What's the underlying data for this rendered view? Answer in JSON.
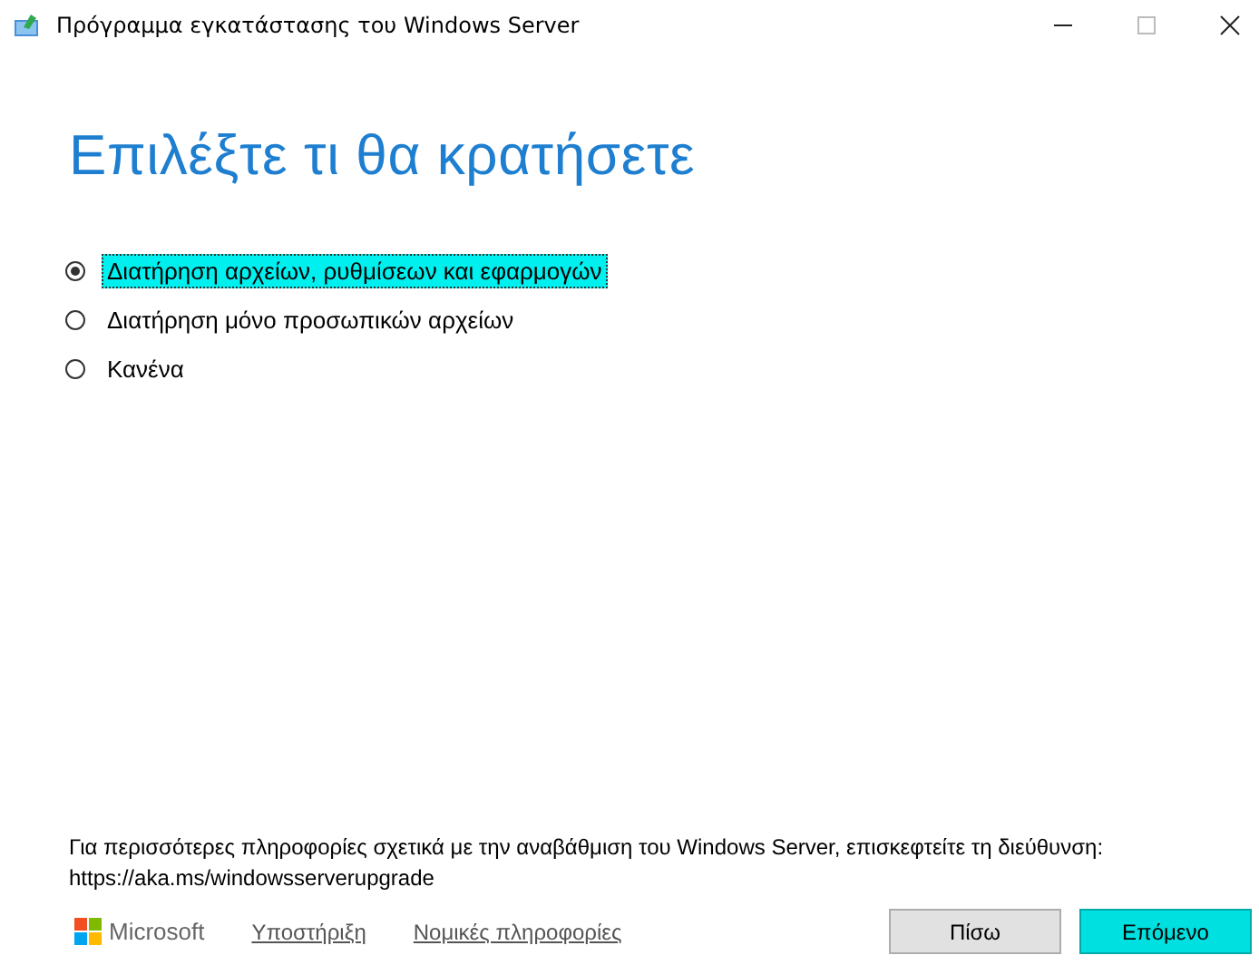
{
  "window": {
    "title": "Πρόγραμμα εγκατάστασης του Windows Server"
  },
  "heading": "Επιλέξτε τι θα κρατήσετε",
  "options": [
    {
      "label": "Διατήρηση αρχείων, ρυθμίσεων και εφαρμογών",
      "selected": true,
      "focused": true
    },
    {
      "label": "Διατήρηση μόνο προσωπικών αρχείων",
      "selected": false,
      "focused": false
    },
    {
      "label": "Κανένα",
      "selected": false,
      "focused": false
    }
  ],
  "info": "Για περισσότερες πληροφορίες σχετικά με την αναβάθμιση του Windows Server, επισκεφτείτε τη διεύθυνση: https://aka.ms/windowsserverupgrade",
  "footer": {
    "brand": "Microsoft",
    "links": [
      "Υποστήριξη",
      "Νομικές πληροφορίες"
    ],
    "buttons": [
      {
        "label": "Πίσω",
        "default": false
      },
      {
        "label": "Επόμενο",
        "default": true
      }
    ]
  }
}
